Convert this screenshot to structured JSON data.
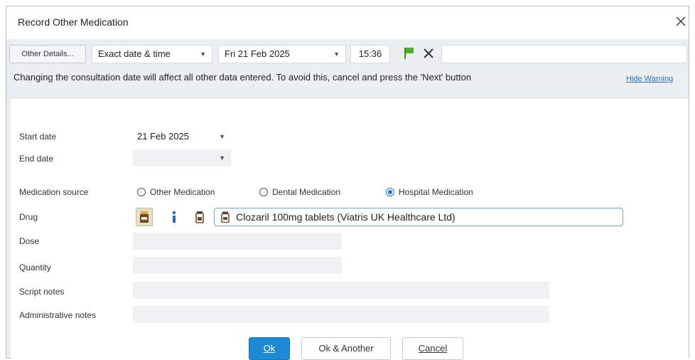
{
  "window": {
    "title": "Record Other Medication"
  },
  "toolbar": {
    "other_details_label": "Other Details...",
    "date_mode": "Exact date & time",
    "date": "Fri 21 Feb 2025",
    "time": "15:36"
  },
  "warning": {
    "text": "Changing the consultation date will affect all other data entered. To avoid this, cancel and press the 'Next' button",
    "hide_label": "Hide Warning"
  },
  "form": {
    "start_date_label": "Start date",
    "start_date_value": "21 Feb 2025",
    "end_date_label": "End date",
    "end_date_value": "",
    "medication_source_label": "Medication source",
    "medication_sources": [
      {
        "label": "Other Medication",
        "selected": false
      },
      {
        "label": "Dental Medication",
        "selected": false
      },
      {
        "label": "Hospital Medication",
        "selected": true
      }
    ],
    "drug_label": "Drug",
    "drug_value": "Clozaril 100mg tablets (Viatris UK Healthcare Ltd)",
    "dose_label": "Dose",
    "quantity_label": "Quantity",
    "script_notes_label": "Script notes",
    "admin_notes_label": "Administrative notes"
  },
  "buttons": {
    "ok": "Ok",
    "ok_another": "Ok & Another",
    "cancel": "Cancel"
  },
  "icons": {
    "close": "close-icon",
    "flag": "green-flag-icon",
    "clear": "x-icon",
    "drug_bottle": "medicine-bottle-icon",
    "info": "info-icon"
  },
  "colors": {
    "accent": "#1e8ad6",
    "link": "#2a6fc7",
    "flag": "#4caf2a",
    "bottle_brown": "#6a4a26",
    "bottle_cap": "#e0a33a"
  }
}
